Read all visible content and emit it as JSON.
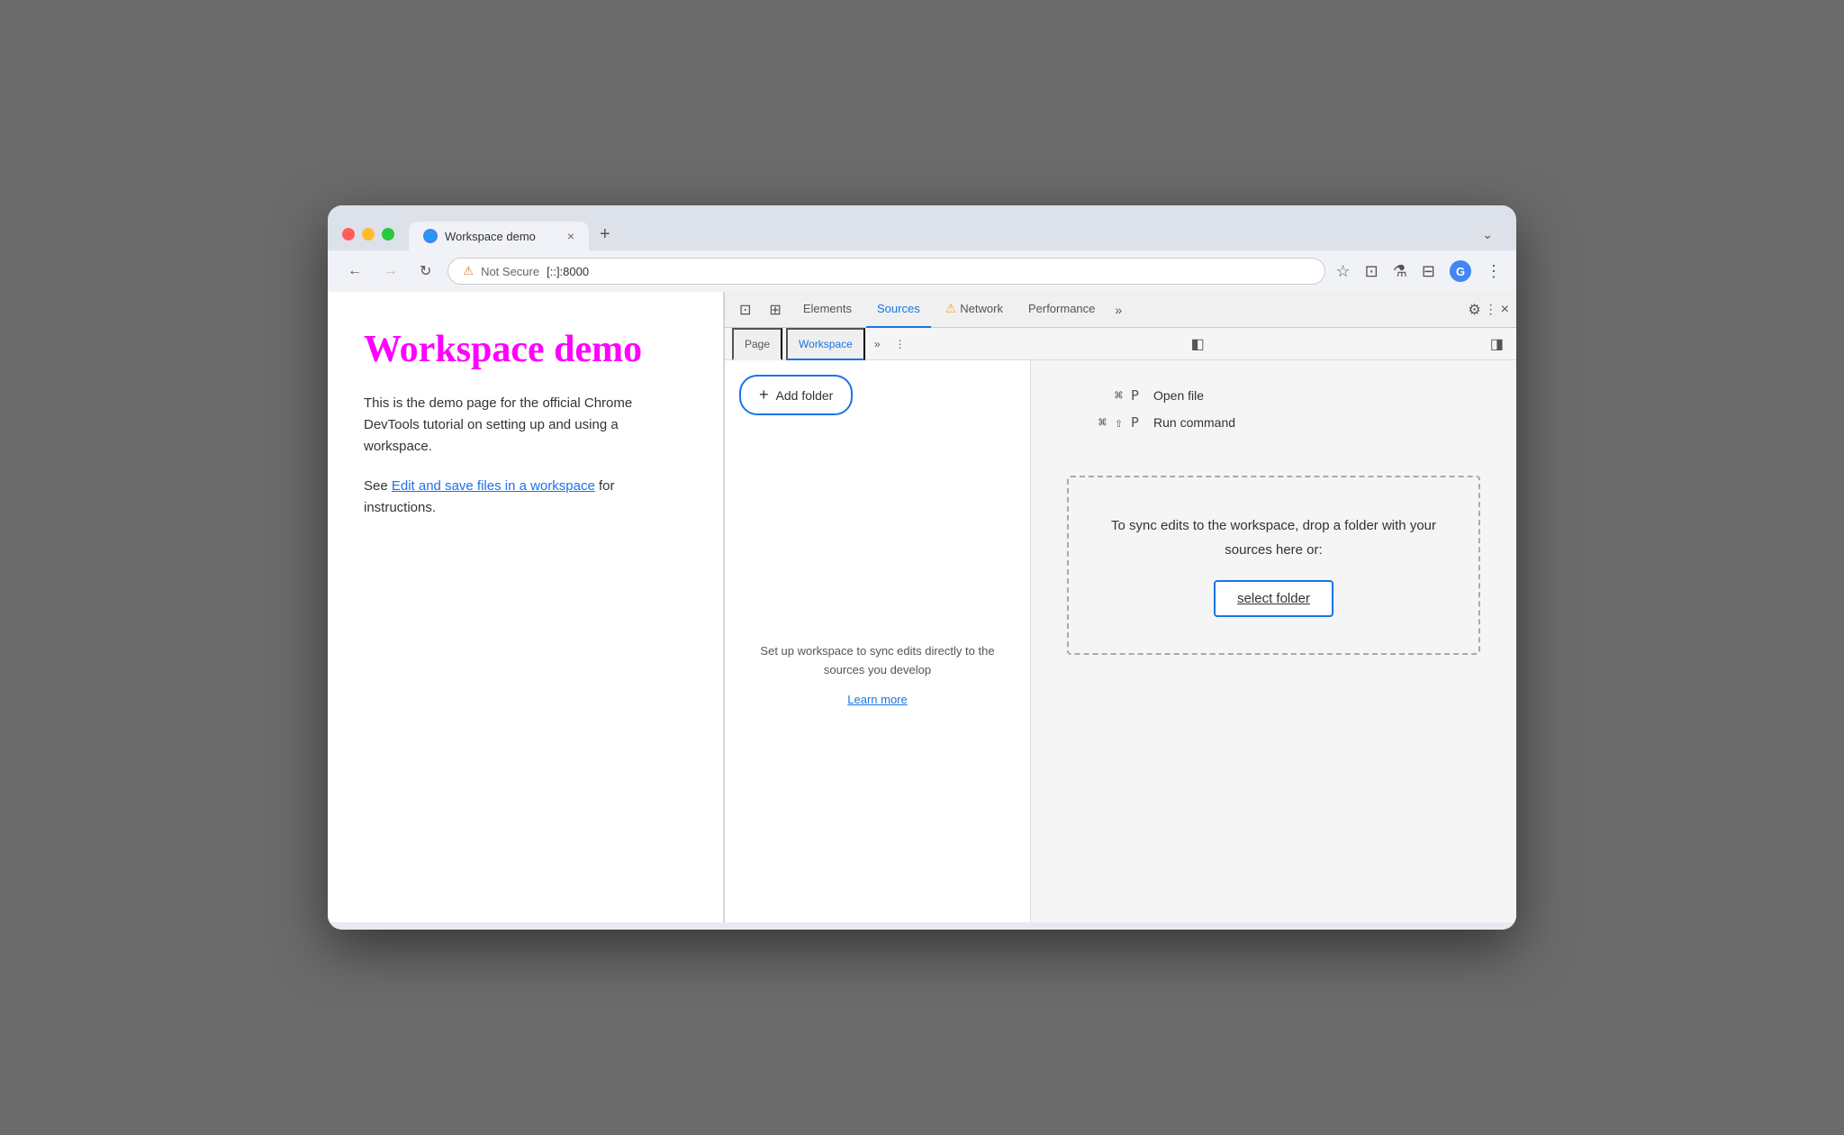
{
  "browser": {
    "tab": {
      "title": "Workspace demo",
      "favicon": "🌐",
      "close_label": "×",
      "new_tab_label": "+"
    },
    "nav": {
      "back_label": "←",
      "forward_label": "→",
      "refresh_label": "↻",
      "not_secure": "Not Secure",
      "url": "[::]:8000",
      "menu_label": "⌄"
    },
    "toolbar": {
      "bookmark_icon": "☆",
      "extensions_icon": "⊡",
      "lab_icon": "⚗",
      "split_icon": "⊟",
      "menu_icon": "⋮"
    }
  },
  "page": {
    "title": "Workspace demo",
    "body1": "This is the demo page for the official Chrome DevTools tutorial on setting up and using a workspace.",
    "body2_prefix": "See ",
    "link_text": "Edit and save files in a workspace",
    "body2_suffix": " for instructions."
  },
  "devtools": {
    "tabs": [
      {
        "label": "Elements",
        "active": false
      },
      {
        "label": "Sources",
        "active": true
      },
      {
        "label": "Network",
        "active": false,
        "warning": true
      },
      {
        "label": "Performance",
        "active": false
      }
    ],
    "more_label": "»",
    "gear_icon": "⚙",
    "dots_icon": "⋮",
    "close_icon": "×",
    "inspect_icon": "⊡",
    "device_icon": "⊞",
    "sources": {
      "tabs": [
        {
          "label": "Page",
          "active": false
        },
        {
          "label": "Workspace",
          "active": true
        }
      ],
      "more_label": "»",
      "dots_label": "⋮",
      "toggle_label": "◧",
      "toggle_right_label": "◨",
      "add_folder_label": "Add folder",
      "plus_label": "+",
      "hint_text": "Set up workspace to sync edits directly to the sources you develop",
      "learn_more_label": "Learn more",
      "shortcuts": [
        {
          "keys": "⌘ P",
          "label": "Open file"
        },
        {
          "keys": "⌘ ⇧ P",
          "label": "Run command"
        }
      ],
      "drop_zone": {
        "text": "To sync edits to the workspace, drop a folder with your sources here or:",
        "button_label": "select folder"
      }
    }
  },
  "colors": {
    "accent_blue": "#1a73e8",
    "page_title_pink": "#ff00ff",
    "warning_yellow": "#f9a825"
  }
}
